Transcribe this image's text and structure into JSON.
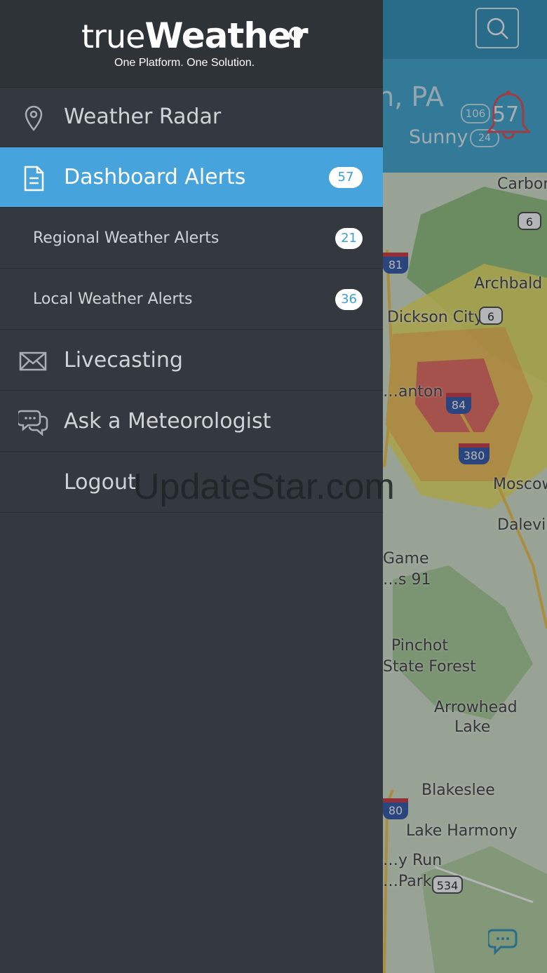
{
  "background": {
    "weather": {
      "city": "…ton, PA",
      "condition": "Sunny",
      "temp_high": "106",
      "temp_low": "24",
      "alert_count": "57"
    },
    "map": {
      "places": [
        "Carbon",
        "Archbald",
        "Dickson City",
        "…anton",
        "Moscow",
        "Dalevill",
        "Game",
        "…s 91",
        "Pinchot",
        "State Forest",
        "Arrowhead",
        "Lake",
        "Blakeslee",
        "Lake Harmony",
        "…y Run",
        "…Park"
      ],
      "highways": [
        "6",
        "6",
        "534"
      ],
      "interstates": [
        "81",
        "84",
        "380",
        "80"
      ]
    }
  },
  "drawer": {
    "logo_true": "true",
    "logo_weather": "Weather",
    "tagline": "One Platform. One Solution.",
    "items": [
      {
        "label": "Weather Radar",
        "icon": "location-pin-icon"
      },
      {
        "label": "Dashboard Alerts",
        "icon": "document-icon",
        "badge": "57"
      },
      {
        "label": "Regional Weather Alerts",
        "badge": "21"
      },
      {
        "label": "Local Weather Alerts",
        "badge": "36"
      },
      {
        "label": "Livecasting",
        "icon": "mail-icon"
      },
      {
        "label": "Ask a Meteorologist",
        "icon": "chat-bubbles-icon"
      },
      {
        "label": "Logout"
      }
    ]
  },
  "watermark": "UpdateStar.com",
  "colors": {
    "accent": "#46a3dc",
    "drawer_bg": "#33393e",
    "header_blue": "#2a8fb8"
  }
}
